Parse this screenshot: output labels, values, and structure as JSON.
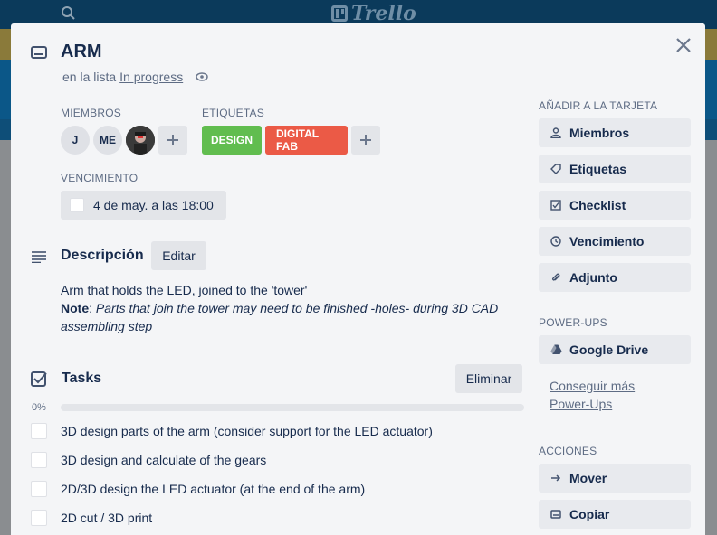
{
  "card": {
    "title": "ARM",
    "in_list_prefix": "en la lista",
    "list_name": "In progress"
  },
  "members": {
    "label": "MIEMBROS",
    "avatars": [
      "J",
      "ME"
    ]
  },
  "labels": {
    "label": "ETIQUETAS",
    "items": [
      {
        "text": "DESIGN",
        "color": "#61bd4f"
      },
      {
        "text": "DIGITAL FAB",
        "color": "#eb5a46"
      }
    ]
  },
  "due": {
    "label": "VENCIMIENTO",
    "value": "4 de may. a las 18:00"
  },
  "description": {
    "heading": "Descripción",
    "edit_label": "Editar",
    "line1": "Arm that holds the LED, joined to the 'tower'",
    "note_label": "Note",
    "note_text": "Parts that join the tower may need to be finished -holes- during 3D CAD assembling step"
  },
  "checklist": {
    "heading": "Tasks",
    "delete_label": "Eliminar",
    "progress_text": "0%",
    "progress": 0,
    "items": [
      "3D design parts of the arm (consider support for the LED actuator)",
      "3D design and calculate of the gears",
      "2D/3D design the LED actuator (at the end of the arm)",
      "2D cut / 3D print"
    ]
  },
  "sidebar": {
    "add_label": "AÑADIR A LA TARJETA",
    "add_items": [
      "Miembros",
      "Etiquetas",
      "Checklist",
      "Vencimiento",
      "Adjunto"
    ],
    "powerups_label": "POWER-UPS",
    "powerups_items": [
      "Google Drive"
    ],
    "powerups_link_1": "Conseguir más",
    "powerups_link_2": "Power-Ups",
    "actions_label": "ACCIONES",
    "action_items": [
      "Mover",
      "Copiar"
    ]
  },
  "colors": {
    "header_bg": "#0b3a5b",
    "modal_bg": "#f4f5f7"
  }
}
